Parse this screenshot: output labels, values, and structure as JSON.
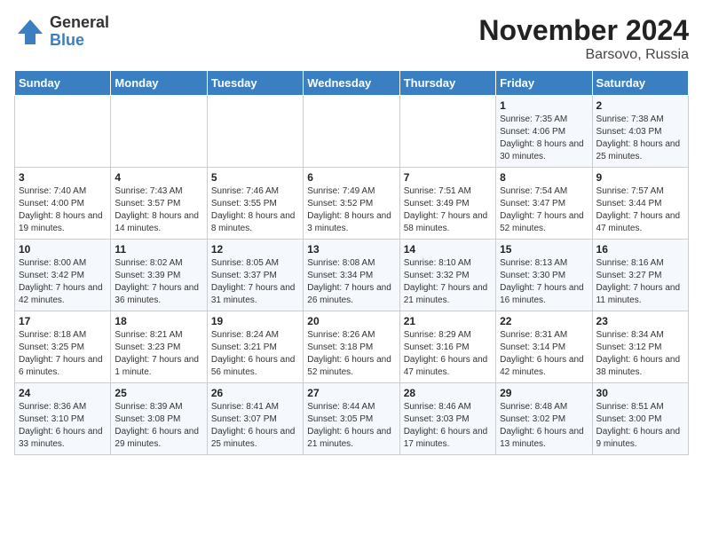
{
  "header": {
    "logo_line1": "General",
    "logo_line2": "Blue",
    "month": "November 2024",
    "location": "Barsovo, Russia"
  },
  "weekdays": [
    "Sunday",
    "Monday",
    "Tuesday",
    "Wednesday",
    "Thursday",
    "Friday",
    "Saturday"
  ],
  "weeks": [
    [
      {
        "day": "",
        "info": ""
      },
      {
        "day": "",
        "info": ""
      },
      {
        "day": "",
        "info": ""
      },
      {
        "day": "",
        "info": ""
      },
      {
        "day": "",
        "info": ""
      },
      {
        "day": "1",
        "info": "Sunrise: 7:35 AM\nSunset: 4:06 PM\nDaylight: 8 hours and 30 minutes."
      },
      {
        "day": "2",
        "info": "Sunrise: 7:38 AM\nSunset: 4:03 PM\nDaylight: 8 hours and 25 minutes."
      }
    ],
    [
      {
        "day": "3",
        "info": "Sunrise: 7:40 AM\nSunset: 4:00 PM\nDaylight: 8 hours and 19 minutes."
      },
      {
        "day": "4",
        "info": "Sunrise: 7:43 AM\nSunset: 3:57 PM\nDaylight: 8 hours and 14 minutes."
      },
      {
        "day": "5",
        "info": "Sunrise: 7:46 AM\nSunset: 3:55 PM\nDaylight: 8 hours and 8 minutes."
      },
      {
        "day": "6",
        "info": "Sunrise: 7:49 AM\nSunset: 3:52 PM\nDaylight: 8 hours and 3 minutes."
      },
      {
        "day": "7",
        "info": "Sunrise: 7:51 AM\nSunset: 3:49 PM\nDaylight: 7 hours and 58 minutes."
      },
      {
        "day": "8",
        "info": "Sunrise: 7:54 AM\nSunset: 3:47 PM\nDaylight: 7 hours and 52 minutes."
      },
      {
        "day": "9",
        "info": "Sunrise: 7:57 AM\nSunset: 3:44 PM\nDaylight: 7 hours and 47 minutes."
      }
    ],
    [
      {
        "day": "10",
        "info": "Sunrise: 8:00 AM\nSunset: 3:42 PM\nDaylight: 7 hours and 42 minutes."
      },
      {
        "day": "11",
        "info": "Sunrise: 8:02 AM\nSunset: 3:39 PM\nDaylight: 7 hours and 36 minutes."
      },
      {
        "day": "12",
        "info": "Sunrise: 8:05 AM\nSunset: 3:37 PM\nDaylight: 7 hours and 31 minutes."
      },
      {
        "day": "13",
        "info": "Sunrise: 8:08 AM\nSunset: 3:34 PM\nDaylight: 7 hours and 26 minutes."
      },
      {
        "day": "14",
        "info": "Sunrise: 8:10 AM\nSunset: 3:32 PM\nDaylight: 7 hours and 21 minutes."
      },
      {
        "day": "15",
        "info": "Sunrise: 8:13 AM\nSunset: 3:30 PM\nDaylight: 7 hours and 16 minutes."
      },
      {
        "day": "16",
        "info": "Sunrise: 8:16 AM\nSunset: 3:27 PM\nDaylight: 7 hours and 11 minutes."
      }
    ],
    [
      {
        "day": "17",
        "info": "Sunrise: 8:18 AM\nSunset: 3:25 PM\nDaylight: 7 hours and 6 minutes."
      },
      {
        "day": "18",
        "info": "Sunrise: 8:21 AM\nSunset: 3:23 PM\nDaylight: 7 hours and 1 minute."
      },
      {
        "day": "19",
        "info": "Sunrise: 8:24 AM\nSunset: 3:21 PM\nDaylight: 6 hours and 56 minutes."
      },
      {
        "day": "20",
        "info": "Sunrise: 8:26 AM\nSunset: 3:18 PM\nDaylight: 6 hours and 52 minutes."
      },
      {
        "day": "21",
        "info": "Sunrise: 8:29 AM\nSunset: 3:16 PM\nDaylight: 6 hours and 47 minutes."
      },
      {
        "day": "22",
        "info": "Sunrise: 8:31 AM\nSunset: 3:14 PM\nDaylight: 6 hours and 42 minutes."
      },
      {
        "day": "23",
        "info": "Sunrise: 8:34 AM\nSunset: 3:12 PM\nDaylight: 6 hours and 38 minutes."
      }
    ],
    [
      {
        "day": "24",
        "info": "Sunrise: 8:36 AM\nSunset: 3:10 PM\nDaylight: 6 hours and 33 minutes."
      },
      {
        "day": "25",
        "info": "Sunrise: 8:39 AM\nSunset: 3:08 PM\nDaylight: 6 hours and 29 minutes."
      },
      {
        "day": "26",
        "info": "Sunrise: 8:41 AM\nSunset: 3:07 PM\nDaylight: 6 hours and 25 minutes."
      },
      {
        "day": "27",
        "info": "Sunrise: 8:44 AM\nSunset: 3:05 PM\nDaylight: 6 hours and 21 minutes."
      },
      {
        "day": "28",
        "info": "Sunrise: 8:46 AM\nSunset: 3:03 PM\nDaylight: 6 hours and 17 minutes."
      },
      {
        "day": "29",
        "info": "Sunrise: 8:48 AM\nSunset: 3:02 PM\nDaylight: 6 hours and 13 minutes."
      },
      {
        "day": "30",
        "info": "Sunrise: 8:51 AM\nSunset: 3:00 PM\nDaylight: 6 hours and 9 minutes."
      }
    ]
  ]
}
